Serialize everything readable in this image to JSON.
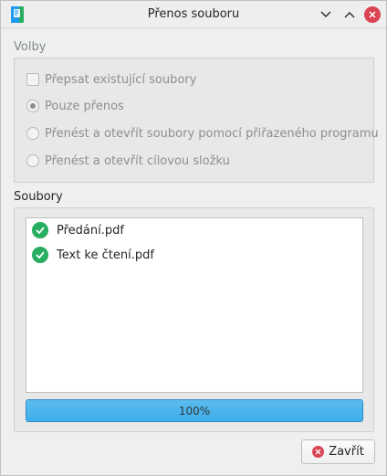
{
  "window": {
    "title": "Přenos souboru"
  },
  "options_group": {
    "label": "Volby",
    "overwrite_checkbox": {
      "label": "Přepsat existující soubory",
      "checked": false
    },
    "radios": [
      {
        "label": "Pouze přenos",
        "selected": true
      },
      {
        "label": "Přenést a otevřít soubory pomocí přiřazeného programu",
        "selected": false
      },
      {
        "label": "Přenést a otevřít cílovou složku",
        "selected": false
      }
    ]
  },
  "files_group": {
    "label": "Soubory",
    "files": [
      {
        "name": "Předání.pdf",
        "status": "done"
      },
      {
        "name": "Text ke čtení.pdf",
        "status": "done"
      }
    ],
    "progress": {
      "value": 100,
      "label": "100%"
    }
  },
  "buttons": {
    "close_label": "Zavřít"
  },
  "colors": {
    "accent": "#3daee9",
    "success": "#27ae60",
    "close": "#da4453"
  }
}
